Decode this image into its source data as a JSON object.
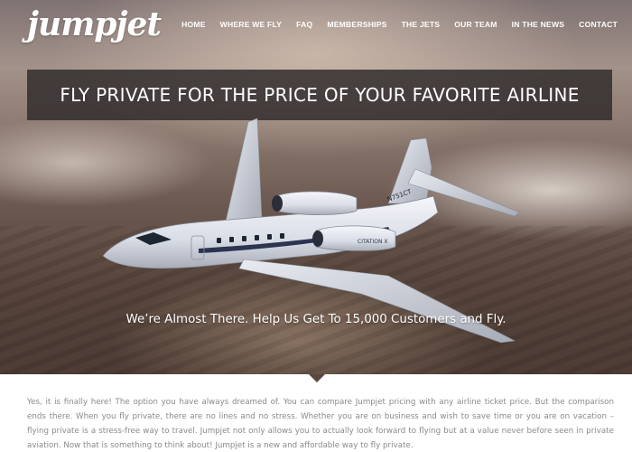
{
  "brand": {
    "logo_text": "jumpjet"
  },
  "nav": {
    "items": [
      {
        "label": "HOME"
      },
      {
        "label": "WHERE WE FLY"
      },
      {
        "label": "FAQ"
      },
      {
        "label": "MEMBERSHIPS"
      },
      {
        "label": "THE JETS"
      },
      {
        "label": "OUR TEAM"
      },
      {
        "label": "IN THE NEWS"
      },
      {
        "label": "CONTACT"
      }
    ]
  },
  "hero": {
    "headline": "FLY PRIVATE FOR THE PRICE OF YOUR FAVORITE AIRLINE",
    "subheadline": "We’re Almost There. Help Us Get To 15,000 Customers and Fly.",
    "jet_tail_number": "N751CT",
    "jet_model": "CITATION X"
  },
  "intro": {
    "text": "Yes, it is finally here! The option you have always dreamed of. You can compare Jumpjet pricing with any airline ticket price. But the comparison ends there. When you fly private, there are no lines and no stress. Whether you are on business and wish to save time or you are on vacation – flying private is a stress-free way to travel. Jumpjet not only allows you to actually look forward to flying but at a value never before seen in private aviation. Now that is something to think about! Jumpjet is a new and affordable way to fly private."
  },
  "colors": {
    "banner_bg": "#2d2a2a",
    "nav_text": "#ffffff",
    "body_text": "#8a8a8a",
    "pointer": "#5a483f"
  },
  "icons": {
    "pointer": "caret-down-icon"
  }
}
